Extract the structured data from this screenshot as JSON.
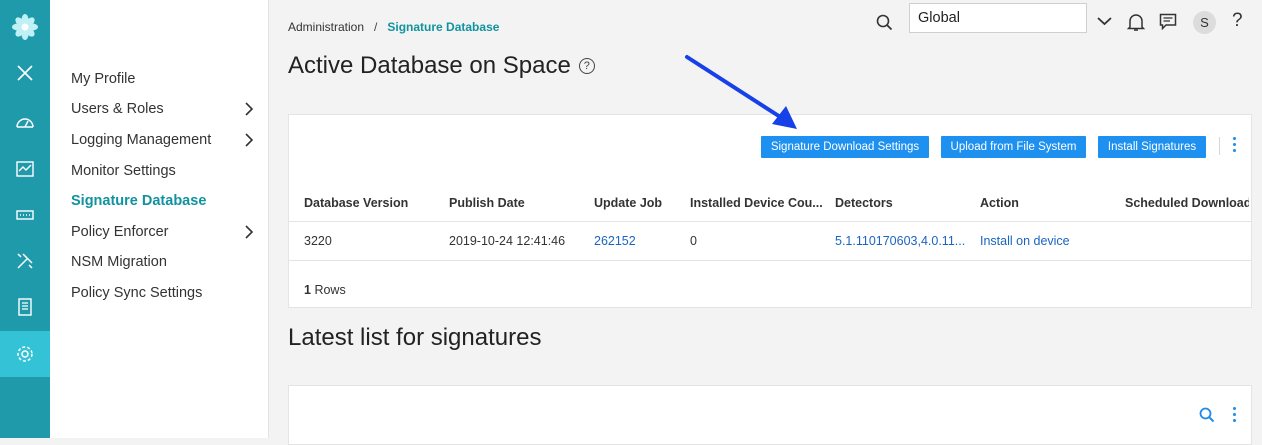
{
  "breadcrumb": {
    "parent": "Administration",
    "separator": "/",
    "current": "Signature Database"
  },
  "page_title": "Active Database on Space",
  "header": {
    "domain_value": "Global",
    "avatar_initial": "S",
    "help_glyph": "?"
  },
  "sidebar": {
    "items": [
      {
        "label": "My Profile"
      },
      {
        "label": "Users & Roles"
      },
      {
        "label": "Logging Management"
      },
      {
        "label": "Monitor Settings"
      },
      {
        "label": "Signature Database"
      },
      {
        "label": "Policy Enforcer"
      },
      {
        "label": "NSM Migration"
      },
      {
        "label": "Policy Sync Settings"
      }
    ]
  },
  "toolbar": {
    "signature_download_settings": "Signature Download Settings",
    "upload_from_file_system": "Upload from File System",
    "install_signatures": "Install Signatures"
  },
  "table": {
    "columns": [
      "Database Version",
      "Publish Date",
      "Update Job",
      "Installed Device Cou...",
      "Detectors",
      "Action",
      "Scheduled Download"
    ],
    "rows": [
      [
        "3220",
        "2019-10-24 12:41:46",
        "262152",
        "0",
        "5.1.110170603,4.0.11...",
        "Install on device",
        ""
      ]
    ],
    "rows_count": "1",
    "rows_label": "Rows"
  },
  "section2_title": "Latest list for signatures",
  "colors": {
    "rail": "#1f9aab",
    "rail_active": "#34c3d6",
    "primary_button": "#1e90f0",
    "accent_text": "#11939f",
    "link": "#1a65c2",
    "annotation_arrow": "#1640e8"
  }
}
